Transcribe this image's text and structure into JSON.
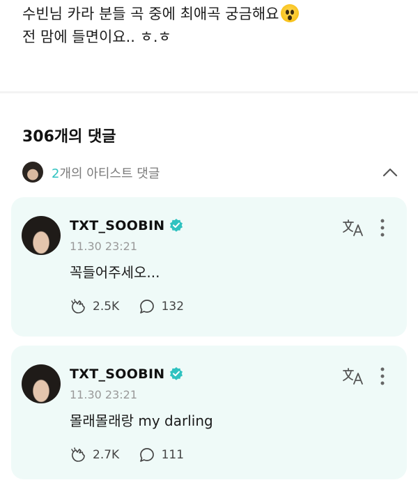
{
  "post": {
    "line1": "수빈님 카라 분들 곡 중에 최애곡 궁금해요",
    "line1_emoji": "shocked-face-emoji",
    "line2": "전 맘에 들면이요.. ㅎ.ㅎ"
  },
  "comments_header": {
    "count_label": "306개의 댓글"
  },
  "artist_comments": {
    "count": "2",
    "label": "개의 아티스트 댓글"
  },
  "comments": [
    {
      "author": "TXT_SOOBIN",
      "time": "11.30 23:21",
      "text": "꼭들어주세오...",
      "likes": "2.5K",
      "replies": "132"
    },
    {
      "author": "TXT_SOOBIN",
      "time": "11.30 23:21",
      "text": "몰래몰래랑 my darling",
      "likes": "2.7K",
      "replies": "111"
    }
  ],
  "colors": {
    "accent": "#2fc2c0",
    "card_bg": "#effaf8",
    "verified": "#2fc2c0"
  },
  "icons": [
    "shocked-face-emoji",
    "chevron-up-icon",
    "verified-badge-icon",
    "translate-icon",
    "more-vertical-icon",
    "cheer-hands-icon",
    "comment-bubble-icon"
  ]
}
